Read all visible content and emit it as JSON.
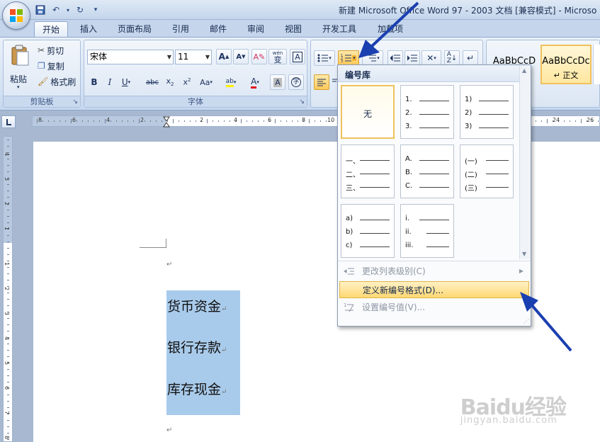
{
  "window": {
    "title": "新建 Microsoft Office Word 97 - 2003 文档 [兼容模式] - Microso"
  },
  "tabs": [
    "开始",
    "插入",
    "页面布局",
    "引用",
    "邮件",
    "审阅",
    "视图",
    "开发工具",
    "加载项"
  ],
  "clipboard": {
    "paste_label": "粘贴",
    "cut_label": "剪切",
    "copy_label": "复制",
    "format_painter_label": "格式刷",
    "group_label": "剪贴板"
  },
  "font": {
    "font_name": "宋体",
    "font_size": "11",
    "group_label": "字体",
    "phonetic_glyph": "wén",
    "phonetic_char": "变"
  },
  "styles": {
    "preview_1": "AaBbCcD",
    "preview_2": "AaBbCcDc",
    "style_2_label": "↵ 正文"
  },
  "numbering_menu": {
    "header": "编号库",
    "none_label": "无",
    "formats": [
      [
        "1.",
        "2.",
        "3."
      ],
      [
        "1)",
        "2)",
        "3)"
      ],
      [
        "一、",
        "二、",
        "三、"
      ],
      [
        "A.",
        "B.",
        "C."
      ],
      [
        "(一)",
        "(二)",
        "(三)"
      ],
      [
        "a)",
        "b)",
        "c)"
      ],
      [
        "i.",
        "ii.",
        "iii."
      ]
    ],
    "change_level": "更改列表级别(C)",
    "define_new": "定义新编号格式(D)...",
    "set_value": "设置编号值(V)..."
  },
  "document": {
    "lines": [
      "货币资金",
      "银行存款",
      "库存现金"
    ]
  },
  "ruler": {
    "h_labels": [
      "8",
      "6",
      "4",
      "2",
      "2",
      "4",
      "6",
      "8",
      "10",
      "24",
      "26"
    ],
    "v_labels": [
      "4",
      "3",
      "2",
      "1",
      "1",
      "2",
      "3",
      "4",
      "5",
      "6",
      "7",
      "8"
    ]
  },
  "watermark": {
    "brand": "Baidu经验",
    "url": "jingyan.baidu.com"
  },
  "colors": {
    "accent_arrow": "#1a3fb0",
    "selection": "#a9cbeb",
    "menu_hot": "#ffd873",
    "font_color_red": "#e0101c",
    "highlight_yellow": "#ffef00"
  }
}
